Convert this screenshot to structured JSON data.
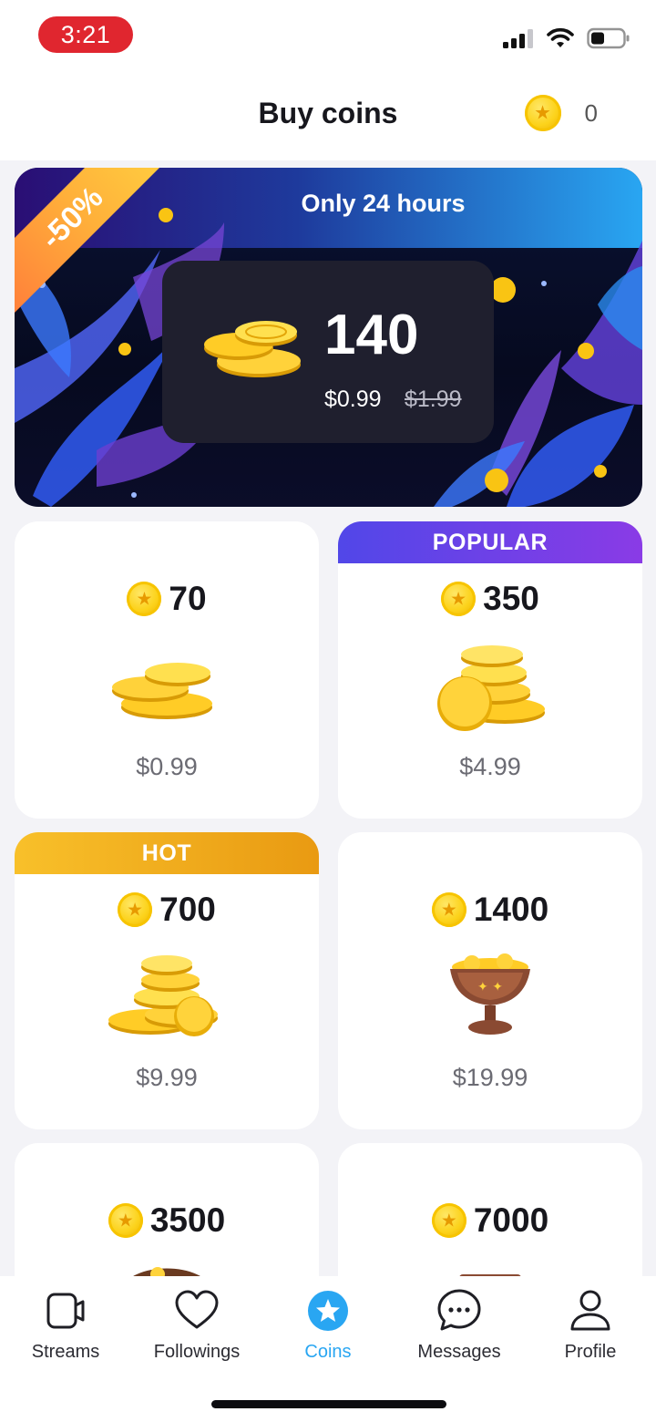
{
  "status_bar": {
    "time": "3:21",
    "icons": [
      "signal-icon",
      "wifi-icon",
      "battery-icon"
    ],
    "time_badge_color": "#e0262f"
  },
  "header": {
    "title": "Buy coins",
    "balance": "0",
    "balance_icon": "coin-icon"
  },
  "promo": {
    "headline": "Only 24 hours",
    "discount": "-50%",
    "amount": "140",
    "price": "$0.99",
    "old_price": "$1.99"
  },
  "packages": [
    {
      "tag": "",
      "amount": "70",
      "price": "$0.99",
      "art": "coin-stack-small-icon"
    },
    {
      "tag": "POPULAR",
      "amount": "350",
      "price": "$4.99",
      "art": "coin-stack-medium-icon"
    },
    {
      "tag": "HOT",
      "amount": "700",
      "price": "$9.99",
      "art": "coin-pile-icon"
    },
    {
      "tag": "",
      "amount": "1400",
      "price": "$19.99",
      "art": "coin-chalice-icon"
    },
    {
      "tag": "",
      "amount": "3500",
      "price": "",
      "art": "coin-chest-icon"
    },
    {
      "tag": "",
      "amount": "7000",
      "price": "",
      "art": "coin-treasure-icon"
    }
  ],
  "tabs": [
    {
      "label": "Streams",
      "icon": "camera-icon"
    },
    {
      "label": "Followings",
      "icon": "heart-icon"
    },
    {
      "label": "Coins",
      "icon": "star-coin-icon",
      "active": true
    },
    {
      "label": "Messages",
      "icon": "chat-bubble-icon"
    },
    {
      "label": "Profile",
      "icon": "person-icon"
    }
  ],
  "colors": {
    "accent": "#29a6f2",
    "popular_tag": "#5147e8",
    "hot_tag": "#f0a91c",
    "coin_gold": "#fcd21a"
  }
}
